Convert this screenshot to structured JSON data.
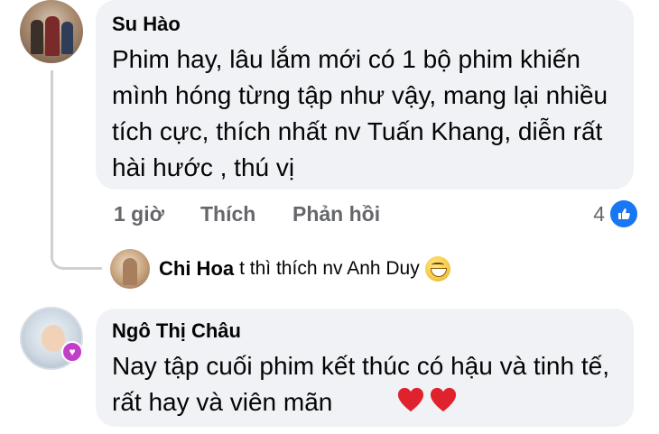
{
  "comments": [
    {
      "author": "Su Hào",
      "text": "Phim hay, lâu lắm mới có 1 bộ phim khiến mình hóng từng tập như vậy, mang lại nhiều tích cực, thích nhất nv Tuấn Khang, diễn rất hài hước , thú vị",
      "time": "1 giờ",
      "like_label": "Thích",
      "reply_label": "Phản hồi",
      "like_count": "4"
    },
    {
      "author": "Ngô Thị Châu",
      "text": "Nay tập cuối phim kết thúc có hậu và tinh tế, rất hay và viên mãn",
      "hearts_icon": "red-heart-emoji"
    }
  ],
  "reply": {
    "author": "Chi Hoa",
    "text": "t thì thích nv Anh Duy",
    "emoji": "grinning-face-emoji"
  },
  "colors": {
    "bubble": "#f0f2f5",
    "meta": "#65676b",
    "like_blue": "#1877f2",
    "heart_red": "#e0222e"
  }
}
